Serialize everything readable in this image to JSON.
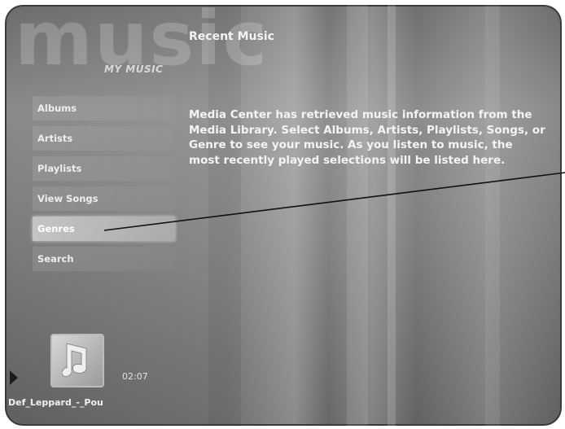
{
  "app": {
    "title": "music",
    "section": "MY MUSIC"
  },
  "main": {
    "heading": "Recent Music",
    "description": "Media Center has retrieved music information from the Media Library. Select Albums, Artists, Playlists, Songs, or Genre to see your music. As you listen to music, the most recently played selections will be listed here."
  },
  "menu": {
    "items": [
      {
        "label": "Albums"
      },
      {
        "label": "Artists"
      },
      {
        "label": "Playlists"
      },
      {
        "label": "View Songs"
      },
      {
        "label": "Genres"
      },
      {
        "label": "Search"
      }
    ],
    "selected": "Genres"
  },
  "now_playing": {
    "elapsed": "02:07",
    "track": "Def_Leppard_-_Pou",
    "icons": [
      "play-icon",
      "album-art-icon"
    ]
  },
  "colors": {
    "background": "#7a7a7a",
    "text": "#f4f4f4",
    "highlight": "#bdbdbd"
  }
}
